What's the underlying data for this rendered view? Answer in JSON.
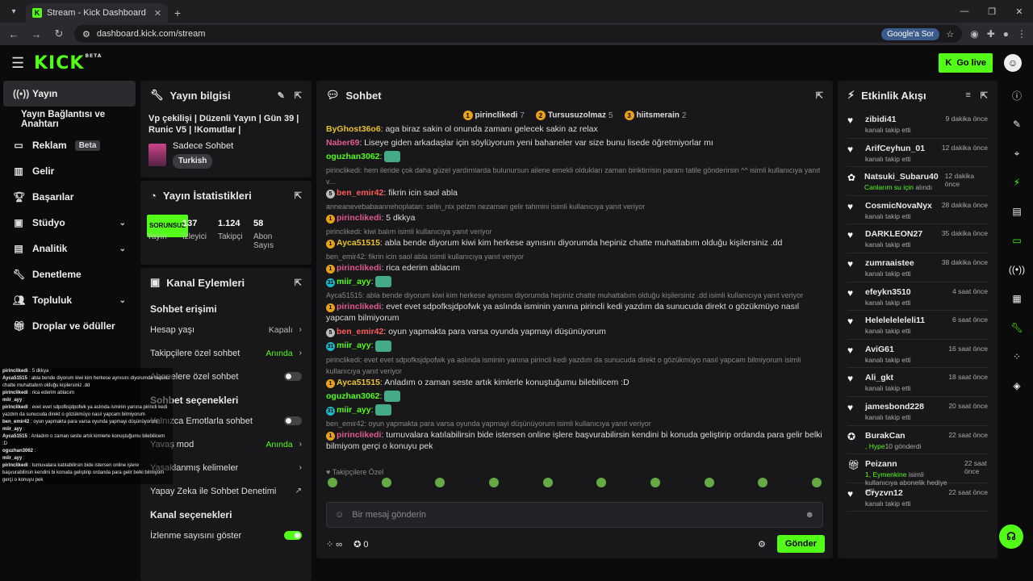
{
  "browser": {
    "tab_title": "Stream - Kick Dashboard",
    "url": "dashboard.kick.com/stream",
    "google_sor": "Google'a Sor"
  },
  "topnav": {
    "logo": "KICK",
    "beta": "BETA",
    "go_live": "Go live"
  },
  "sidebar": {
    "items": [
      {
        "label": "Yayın",
        "icon": "signal-icon",
        "active": true
      },
      {
        "label": "Yayın Bağlantısı ve Anahtarı",
        "sub": true
      },
      {
        "label": "Reklam",
        "icon": "ad-icon",
        "badge": "Beta"
      },
      {
        "label": "Gelir",
        "icon": "chart-icon"
      },
      {
        "label": "Başarılar",
        "icon": "trophy-icon"
      },
      {
        "label": "Stüdyo",
        "icon": "studio-icon",
        "chevron": true
      },
      {
        "label": "Analitik",
        "icon": "analytics-icon",
        "chevron": true
      },
      {
        "label": "Denetleme",
        "icon": "wrench-icon"
      },
      {
        "label": "Topluluk",
        "icon": "community-icon",
        "chevron": true
      },
      {
        "label": "Droplar ve ödüller",
        "icon": "gift-icon"
      }
    ]
  },
  "stream_info": {
    "title": "Yayın bilgisi",
    "stream_title": "Vp çekilişi | Düzenli Yayın | Gün 39 | Runic V5 | !Komutlar |",
    "category": "Sadece Sohbet",
    "tag": "Turkish"
  },
  "stream_stats": {
    "title": "Yayın İstatistikleri",
    "items": [
      {
        "value": "SORUNSUZ",
        "label": "Yayın"
      },
      {
        "value": "137",
        "label": "İzleyici"
      },
      {
        "value": "1.124",
        "label": "Takipçi"
      },
      {
        "value": "58",
        "label": "Abon Sayıs"
      }
    ]
  },
  "channel_actions": {
    "title": "Kanal Eylemleri",
    "section1": "Sohbet erişimi",
    "rows1": [
      {
        "label": "Hesap yaşı",
        "value": "Kapalı",
        "type": "arrow"
      },
      {
        "label": "Takipçilere özel sohbet",
        "value": "Anında",
        "type": "arrow",
        "green": true
      },
      {
        "label": "Abonelere özel sohbet",
        "type": "toggle",
        "on": false
      }
    ],
    "section2": "Sohbet seçenekleri",
    "rows2": [
      {
        "label": "Yalnızca Emotlarla sohbet",
        "type": "toggle",
        "on": false
      },
      {
        "label": "Yavaş mod",
        "value": "Anında",
        "type": "arrow",
        "green": true
      },
      {
        "label": "Yasaklanmış kelimeler",
        "value": "",
        "type": "arrow"
      },
      {
        "label": "Yapay Zeka ile Sohbet Denetimi",
        "value": "",
        "type": "link"
      }
    ],
    "section3": "Kanal seçenekleri",
    "rows3": [
      {
        "label": "İzlenme sayısını göster",
        "type": "toggle",
        "on": true
      }
    ]
  },
  "chat": {
    "title": "Sohbet",
    "pinned": [
      {
        "rank": "1",
        "name": "pirinclikedi",
        "count": "7"
      },
      {
        "rank": "2",
        "name": "Tursusuzolmaz",
        "count": "5"
      },
      {
        "rank": "3",
        "name": "hiitsmerain",
        "count": "2"
      }
    ],
    "messages": [
      {
        "user": "ByGhost36o6",
        "color": "#e8c22b",
        "text": "aga biraz sakin ol onunda zamanı gelecek sakin az relax"
      },
      {
        "user": "Naber69",
        "color": "#e05a8b",
        "text": "Liseye giden arkadaşlar için söylüyorum yeni bahaneler var size bunu lisede öğretmiyorlar mı"
      },
      {
        "user": "oguzhan3062",
        "color": "#53fc18",
        "text": "",
        "emote": true
      },
      {
        "reply": "pirinclikedi: hem ileride çok daha güzel yardımlarda bulunursun ailene emekli oldukları zaman biriktirrisin paranı tatile gönderirsin ^^ isimli kullanıcıya yanıt v...",
        "user": "ben_emir42",
        "color": "#ff5a5a",
        "badge": "5",
        "text": "fikrin icin saol abla"
      },
      {
        "reply": "anneanevebabaannehoplatan: selin_nix pelzm nezaman gelir tahmini isimli kullanıcıya yanıt veriyor",
        "user": "pirinclikedi",
        "color": "#e05a8b",
        "badge": "1",
        "text": "5 dkkya"
      },
      {
        "reply": "pirinclikedi: kiwi balım isimli kullanıcıya yanıt veriyor",
        "user": "Ayca51515",
        "color": "#e8c22b",
        "badge": "1",
        "text": "abla bende diyorum kiwi kim herkese aynısını diyorumda hepiniz chatte muhattabım olduğu kişilersiniz .dd"
      },
      {
        "reply": "ben_emir42: fikrin icin saol abla isimli kullanıcıya yanıt veriyor",
        "user": "pirinclikedi",
        "color": "#e05a8b",
        "badge": "1",
        "text": "rica ederim ablacım"
      },
      {
        "user": "miir_ayy",
        "color": "#53fc18",
        "badge": "31",
        "text": "",
        "emote": true
      },
      {
        "reply": "Ayca51515: abla bende diyorum kiwi kim herkese aynısını diyorumda hepiniz chatte muhattabım olduğu kişilersiniz .dd isimli kullanıcıya yanıt veriyor",
        "user": "pirinclikedi",
        "color": "#e05a8b",
        "badge": "1",
        "text": "evet evet sdpofksjdpofwk ya aslında isminin yanına pirincli kedi yazdım da sunucuda direkt o gözükmüyo nasıl yapcam bilmiyorum"
      },
      {
        "user": "ben_emir42",
        "color": "#ff5a5a",
        "badge": "5",
        "text": "oyun yapmakta para varsa oyunda yapmayi düşünüyorum"
      },
      {
        "user": "miir_ayy",
        "color": "#53fc18",
        "badge": "31",
        "text": "",
        "emote": true
      },
      {
        "reply": "pirinclikedi: evet evet sdpofksjdpofwk ya aslında isminin yanına pirincli kedi yazdım da sunucuda direkt o gözükmüyo nasıl yapcam bilmiyorum isimli kullanıcıya yanıt veriyor",
        "user": "Ayca51515",
        "color": "#e8c22b",
        "badge": "1",
        "text": "Anladım o zaman seste artık kimlerle konuştuğumu bilebilicem :D"
      },
      {
        "user": "oguzhan3062",
        "color": "#53fc18",
        "text": "",
        "emote": true
      },
      {
        "user": "miir_ayy",
        "color": "#53fc18",
        "badge": "31",
        "text": "",
        "emote": true
      },
      {
        "reply": "ben_emir42: oyun yapmakta para varsa oyunda yapmayi düşünüyorum isimli kullanıcıya yanıt veriyor",
        "user": "pirinclikedi",
        "color": "#e05a8b",
        "badge": "1",
        "text": "turnuvalara katılabilirsin bide istersen online işlere başvurabilirsin kendini bi konuda geliştirip ordanda para gelir belki bilmiyom gerçi o konuyu pek"
      }
    ],
    "followers_only": "Takipçilere Özel",
    "input_placeholder": "Bir mesaj gönderin",
    "infinity": "∞",
    "count": "0",
    "send": "Gönder"
  },
  "activity": {
    "title": "Etkinlik Akışı",
    "events": [
      {
        "name": "zibidi41",
        "desc": "kanalı takip etti",
        "time": "9 dakika önce",
        "icon": "heart-icon"
      },
      {
        "name": "ArifCeyhun_01",
        "desc": "kanalı takip etti",
        "time": "12 dakika önce",
        "icon": "heart-icon"
      },
      {
        "name": "Natsuki_Subaru40",
        "desc": "Canlarım su için",
        "desc2": " alındı",
        "time": "12 dakika önce",
        "icon": "reward-icon",
        "green": true
      },
      {
        "name": "CosmicNovaNyx",
        "desc": "kanalı takip etti",
        "time": "28 dakika önce",
        "icon": "heart-icon"
      },
      {
        "name": "DARKLEON27",
        "desc": "kanalı takip etti",
        "time": "35 dakika önce",
        "icon": "heart-icon"
      },
      {
        "name": "zumraaistee",
        "desc": "kanalı takip etti",
        "time": "38 dakika önce",
        "icon": "heart-icon"
      },
      {
        "name": "efeykn3510",
        "desc": "kanalı takip etti",
        "time": "4 saat önce",
        "icon": "heart-icon"
      },
      {
        "name": "Heleleleleleli11",
        "desc": "kanalı takip etti",
        "time": "6 saat önce",
        "icon": "heart-icon"
      },
      {
        "name": "AviG61",
        "desc": "kanalı takip etti",
        "time": "16 saat önce",
        "icon": "heart-icon"
      },
      {
        "name": "Ali_gkt",
        "desc": "kanalı takip etti",
        "time": "18 saat önce",
        "icon": "heart-icon"
      },
      {
        "name": "jamesbond228",
        "desc": "kanalı takip etti",
        "time": "20 saat önce",
        "icon": "heart-icon"
      },
      {
        "name": "BurakCan",
        "desc": ", Hype",
        "desc2": "10 gönderdi",
        "time": "22 saat önce",
        "icon": "hype-icon",
        "green": true
      },
      {
        "name": "Peizann",
        "desc": "1, Eymenkine",
        "desc2": " isimli kullanıcıya abonelik hediye etti.",
        "time": "22 saat önce",
        "icon": "gift-icon",
        "green": true
      },
      {
        "name": "Cryzvn12",
        "desc": "kanalı takip etti",
        "time": "22 saat önce",
        "icon": "heart-icon"
      }
    ]
  },
  "overlay": [
    {
      "u": "pirinclikedi",
      "t": "5 dkkya"
    },
    {
      "u": "Ayca51515",
      "t": "abla bende diyorum kiwi kim herkese aynısını diyorumda hepiniz chatte muhattabım olduğu kişilersiniz .dd"
    },
    {
      "u": "pirinclikedi",
      "t": "rica ederim ablacım"
    },
    {
      "u": "miir_ayy",
      "t": ""
    },
    {
      "u": "pirinclikedi",
      "t": "evet evet sdpofksjdpofwk ya aslında isminin yanına pirincli kedi yazdım da sunucuda direkt o gözükmüyo nasıl yapcam bilmiyorum"
    },
    {
      "u": "ben_emir42",
      "t": "oyun yapmakta para varsa oyunda yapmayi düşünüyorum"
    },
    {
      "u": "miir_ayy",
      "t": ""
    },
    {
      "u": "Ayca51515",
      "t": "Anladım o zaman seste artık kimlerle konuştuğumu bilebilicem :D"
    },
    {
      "u": "oguzhan3062",
      "t": ""
    },
    {
      "u": "miir_ayy",
      "t": ""
    },
    {
      "u": "pirinclikedi",
      "t": "turnuvalara katılabilirsin bide istersen online işlere başvurabilirsin kendini bi konuda geliştirip ordanda para gelir belki bilmiyom gerçi o konuyu pek"
    }
  ]
}
